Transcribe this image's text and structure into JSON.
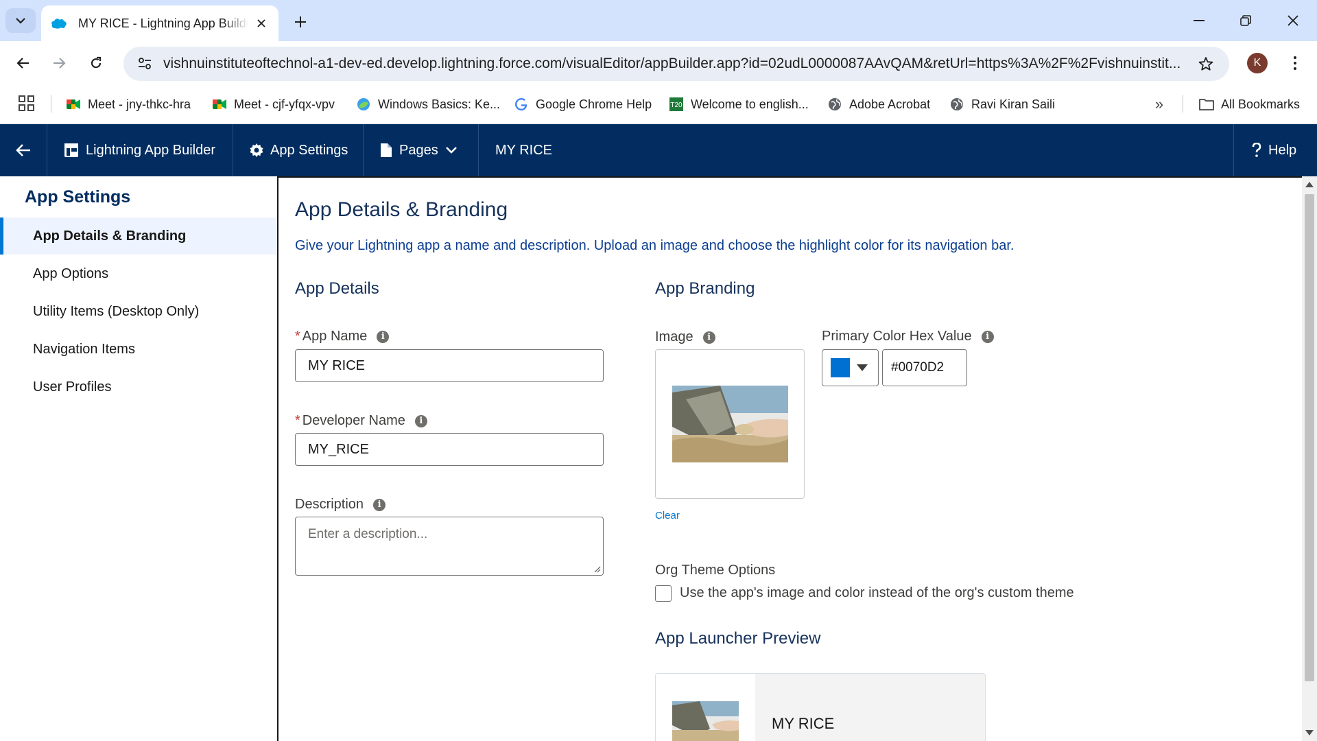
{
  "browser": {
    "tab_title": "MY RICE - Lightning App Builder",
    "url": "vishnuinstituteoftechnol-a1-dev-ed.develop.lightning.force.com/visualEditor/appBuilder.app?id=02udL0000087AAvQAM&retUrl=https%3A%2F%2Fvishnuinstit...",
    "profile_initial": "K",
    "bookmarks": [
      {
        "label": "Meet - jny-thkc-hra",
        "icon": "google-meet-icon"
      },
      {
        "label": "Meet - cjf-yfqx-vpv",
        "icon": "google-meet-icon"
      },
      {
        "label": "Windows Basics: Ke...",
        "icon": "edge-globe-icon"
      },
      {
        "label": "Google Chrome Help",
        "icon": "google-g-icon"
      },
      {
        "label": "Welcome to english...",
        "icon": "t20-icon"
      },
      {
        "label": "Adobe Acrobat",
        "icon": "globe-icon"
      },
      {
        "label": "Ravi Kiran Saili",
        "icon": "globe-icon"
      }
    ],
    "all_bookmarks_label": "All Bookmarks",
    "more_label": "»"
  },
  "header": {
    "builder_label": "Lightning App Builder",
    "app_settings_label": "App Settings",
    "pages_label": "Pages",
    "app_name": "MY RICE",
    "help_label": "Help"
  },
  "sidebar": {
    "title": "App Settings",
    "items": [
      {
        "label": "App Details & Branding",
        "active": true
      },
      {
        "label": "App Options",
        "active": false
      },
      {
        "label": "Utility Items (Desktop Only)",
        "active": false
      },
      {
        "label": "Navigation Items",
        "active": false
      },
      {
        "label": "User Profiles",
        "active": false
      }
    ]
  },
  "main": {
    "title": "App Details & Branding",
    "description": "Give your Lightning app a name and description. Upload an image and choose the highlight color for its navigation bar.",
    "details": {
      "heading": "App Details",
      "app_name_label": "App Name",
      "app_name_value": "MY RICE",
      "dev_name_label": "Developer Name",
      "dev_name_value": "MY_RICE",
      "description_label": "Description",
      "description_placeholder": "Enter a description..."
    },
    "branding": {
      "heading": "App Branding",
      "image_label": "Image",
      "clear_label": "Clear",
      "color_label": "Primary Color Hex Value",
      "color_value": "#0070D2",
      "org_theme_label": "Org Theme Options",
      "org_theme_checkbox_label": "Use the app's image and color instead of the org's custom theme",
      "org_theme_checked": false,
      "preview_heading": "App Launcher Preview",
      "preview_app_name": "MY RICE"
    }
  },
  "colors": {
    "sf_header": "#032d60",
    "accent": "#0176d3",
    "primary_swatch": "#0070d2",
    "chrome_tabstrip": "#d3e3fd"
  }
}
